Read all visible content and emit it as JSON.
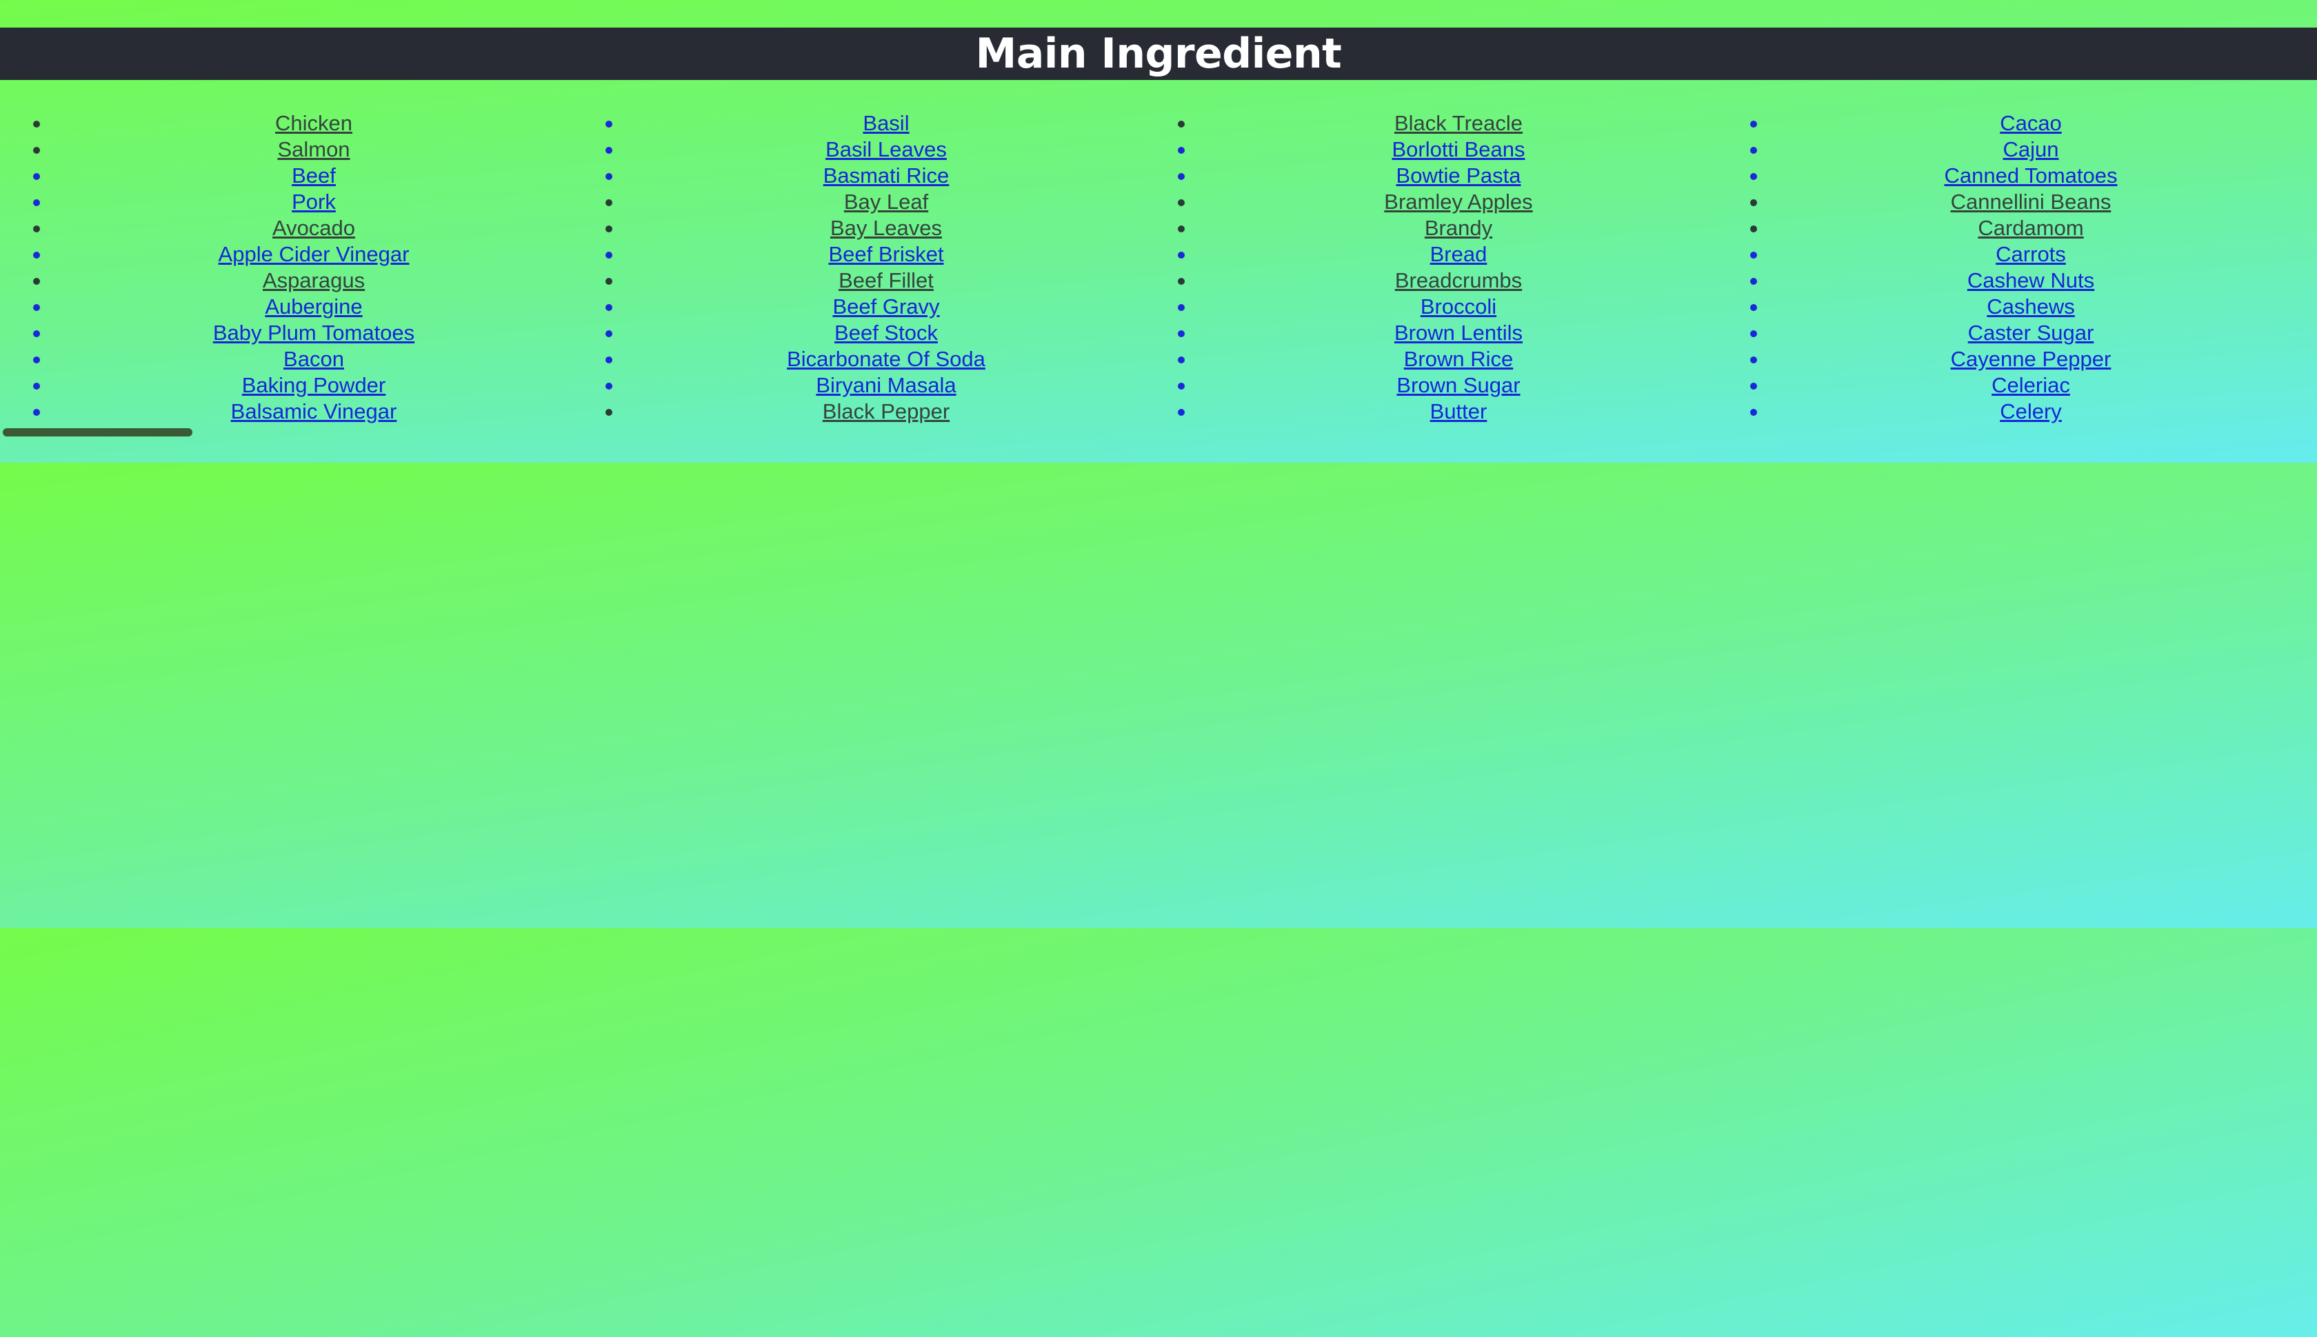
{
  "header": {
    "title": "Main Ingredient"
  },
  "columns": [
    {
      "items": [
        {
          "label": "Chicken",
          "visited": true
        },
        {
          "label": "Salmon",
          "visited": true
        },
        {
          "label": "Beef",
          "visited": false
        },
        {
          "label": "Pork",
          "visited": false
        },
        {
          "label": "Avocado",
          "visited": true
        },
        {
          "label": "Apple Cider Vinegar",
          "visited": false
        },
        {
          "label": "Asparagus",
          "visited": true
        },
        {
          "label": "Aubergine",
          "visited": false
        },
        {
          "label": "Baby Plum Tomatoes",
          "visited": false
        },
        {
          "label": "Bacon",
          "visited": false
        },
        {
          "label": "Baking Powder",
          "visited": false
        },
        {
          "label": "Balsamic Vinegar",
          "visited": false
        }
      ]
    },
    {
      "items": [
        {
          "label": "Basil",
          "visited": false
        },
        {
          "label": "Basil Leaves",
          "visited": false
        },
        {
          "label": "Basmati Rice",
          "visited": false
        },
        {
          "label": "Bay Leaf",
          "visited": true
        },
        {
          "label": "Bay Leaves",
          "visited": true
        },
        {
          "label": "Beef Brisket",
          "visited": false
        },
        {
          "label": "Beef Fillet",
          "visited": true
        },
        {
          "label": "Beef Gravy",
          "visited": false
        },
        {
          "label": "Beef Stock",
          "visited": false
        },
        {
          "label": "Bicarbonate Of Soda",
          "visited": false
        },
        {
          "label": "Biryani Masala",
          "visited": false
        },
        {
          "label": "Black Pepper",
          "visited": true
        }
      ]
    },
    {
      "items": [
        {
          "label": "Black Treacle",
          "visited": true
        },
        {
          "label": "Borlotti Beans",
          "visited": false
        },
        {
          "label": "Bowtie Pasta",
          "visited": false
        },
        {
          "label": "Bramley Apples",
          "visited": true
        },
        {
          "label": "Brandy",
          "visited": true
        },
        {
          "label": "Bread",
          "visited": false
        },
        {
          "label": "Breadcrumbs",
          "visited": true
        },
        {
          "label": "Broccoli",
          "visited": false
        },
        {
          "label": "Brown Lentils",
          "visited": false
        },
        {
          "label": "Brown Rice",
          "visited": false
        },
        {
          "label": "Brown Sugar",
          "visited": false
        },
        {
          "label": "Butter",
          "visited": false
        }
      ]
    },
    {
      "items": [
        {
          "label": "Cacao",
          "visited": false
        },
        {
          "label": "Cajun",
          "visited": false
        },
        {
          "label": "Canned Tomatoes",
          "visited": false
        },
        {
          "label": "Cannellini Beans",
          "visited": true
        },
        {
          "label": "Cardamom",
          "visited": true
        },
        {
          "label": "Carrots",
          "visited": false
        },
        {
          "label": "Cashew Nuts",
          "visited": false
        },
        {
          "label": "Cashews",
          "visited": false
        },
        {
          "label": "Caster Sugar",
          "visited": false
        },
        {
          "label": "Cayenne Pepper",
          "visited": false
        },
        {
          "label": "Celeriac",
          "visited": false
        },
        {
          "label": "Celery",
          "visited": false
        }
      ]
    }
  ]
}
